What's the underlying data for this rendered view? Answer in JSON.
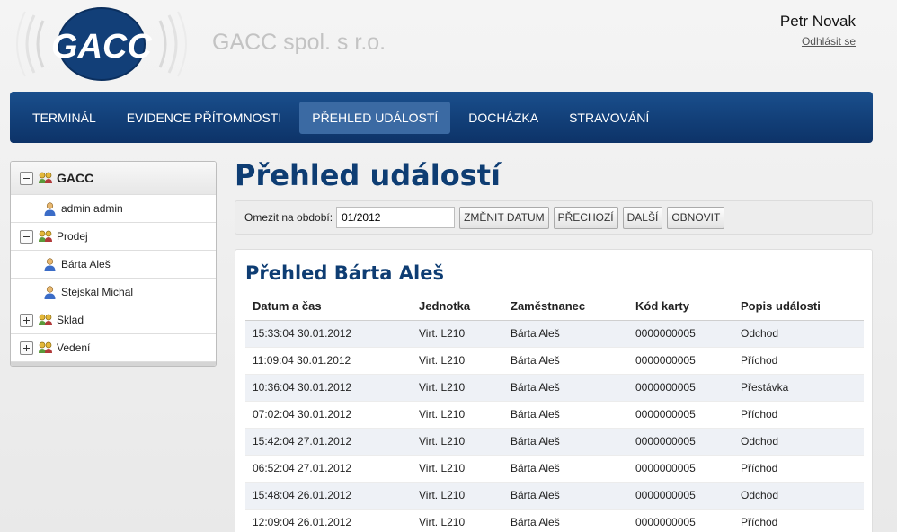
{
  "header": {
    "logo_text": "GACC",
    "company": "GACC spol. s r.o.",
    "user_name": "Petr Novak",
    "logout": "Odhlásit se"
  },
  "nav": {
    "items": [
      {
        "label": "TERMINÁL",
        "active": false
      },
      {
        "label": "EVIDENCE PŘÍTOMNOSTI",
        "active": false
      },
      {
        "label": "PŘEHLED UDÁLOSTÍ",
        "active": true
      },
      {
        "label": "DOCHÁZKA",
        "active": false
      },
      {
        "label": "STRAVOVÁNÍ",
        "active": false
      }
    ]
  },
  "sidebar": {
    "items": [
      {
        "label": "GACC",
        "type": "group",
        "toggle": "minus"
      },
      {
        "label": "admin admin",
        "type": "user"
      },
      {
        "label": "Prodej",
        "type": "group",
        "toggle": "minus"
      },
      {
        "label": "Bárta Aleš",
        "type": "user"
      },
      {
        "label": "Stejskal Michal",
        "type": "user"
      },
      {
        "label": "Sklad",
        "type": "group",
        "toggle": "plus"
      },
      {
        "label": "Vedení",
        "type": "group",
        "toggle": "plus"
      }
    ]
  },
  "main": {
    "title": "Přehled událostí",
    "filter": {
      "label": "Omezit na období:",
      "value": "01/2012",
      "buttons": [
        "ZMĚNIT DATUM",
        "PŘECHOZÍ",
        "DALŠÍ",
        "OBNOVIT"
      ]
    },
    "panel_title": "Přehled Bárta Aleš",
    "columns": [
      "Datum a čas",
      "Jednotka",
      "Zaměstnanec",
      "Kód karty",
      "Popis události"
    ],
    "rows": [
      [
        "15:33:04 30.01.2012",
        "Virt. L210",
        "Bárta Aleš",
        "0000000005",
        "Odchod"
      ],
      [
        "11:09:04 30.01.2012",
        "Virt. L210",
        "Bárta Aleš",
        "0000000005",
        "Příchod"
      ],
      [
        "10:36:04 30.01.2012",
        "Virt. L210",
        "Bárta Aleš",
        "0000000005",
        "Přestávka"
      ],
      [
        "07:02:04 30.01.2012",
        "Virt. L210",
        "Bárta Aleš",
        "0000000005",
        "Příchod"
      ],
      [
        "15:42:04 27.01.2012",
        "Virt. L210",
        "Bárta Aleš",
        "0000000005",
        "Odchod"
      ],
      [
        "06:52:04 27.01.2012",
        "Virt. L210",
        "Bárta Aleš",
        "0000000005",
        "Příchod"
      ],
      [
        "15:48:04 26.01.2012",
        "Virt. L210",
        "Bárta Aleš",
        "0000000005",
        "Odchod"
      ],
      [
        "12:09:04 26.01.2012",
        "Virt. L210",
        "Bárta Aleš",
        "0000000005",
        "Příchod"
      ]
    ]
  },
  "colors": {
    "nav_bg": "#123f78",
    "nav_active": "#3b6aa3",
    "title": "#0e3d73",
    "row_alt": "#eef1f6"
  }
}
